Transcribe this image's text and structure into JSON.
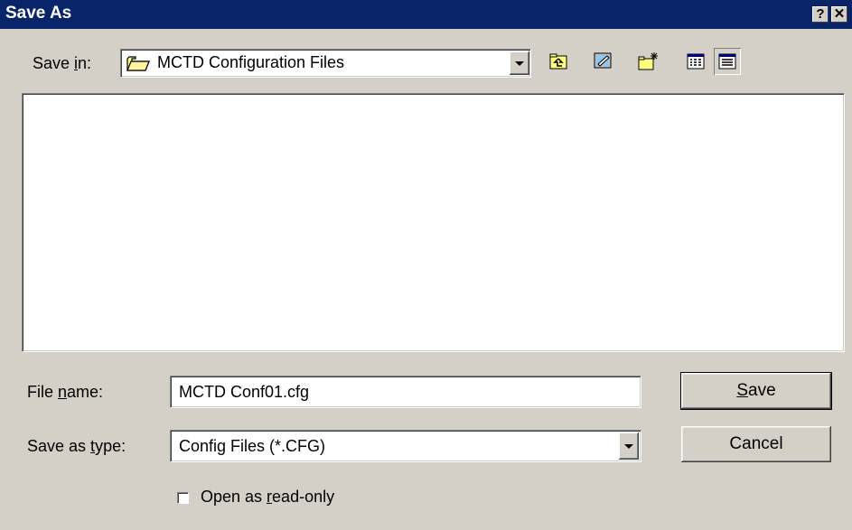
{
  "window": {
    "title": "Save As",
    "help_glyph": "?",
    "close_glyph": "✕"
  },
  "save_in": {
    "label_pre": "Save ",
    "label_accel": "i",
    "label_post": "n:",
    "value": "MCTD Configuration Files",
    "folder_icon": "folder-icon"
  },
  "toolbar": {
    "buttons": [
      "up-one-level-icon",
      "desktop-icon",
      "new-folder-icon",
      "list-view-icon",
      "details-view-icon"
    ]
  },
  "file_name": {
    "label_pre": "File ",
    "label_accel": "n",
    "label_post": "ame:",
    "value": "MCTD Conf01.cfg"
  },
  "save_as_type": {
    "label_pre": "Save as ",
    "label_accel": "t",
    "label_post": "ype:",
    "value": "Config Files (*.CFG)"
  },
  "buttons": {
    "save_accel": "S",
    "save_rest": "ave",
    "cancel": "Cancel"
  },
  "read_only": {
    "label_pre": "Open as ",
    "label_accel": "r",
    "label_post": "ead-only",
    "checked": false
  },
  "colors": {
    "titlebar": "#0a246a",
    "face": "#d4d0c8",
    "window": "#ffffff"
  }
}
